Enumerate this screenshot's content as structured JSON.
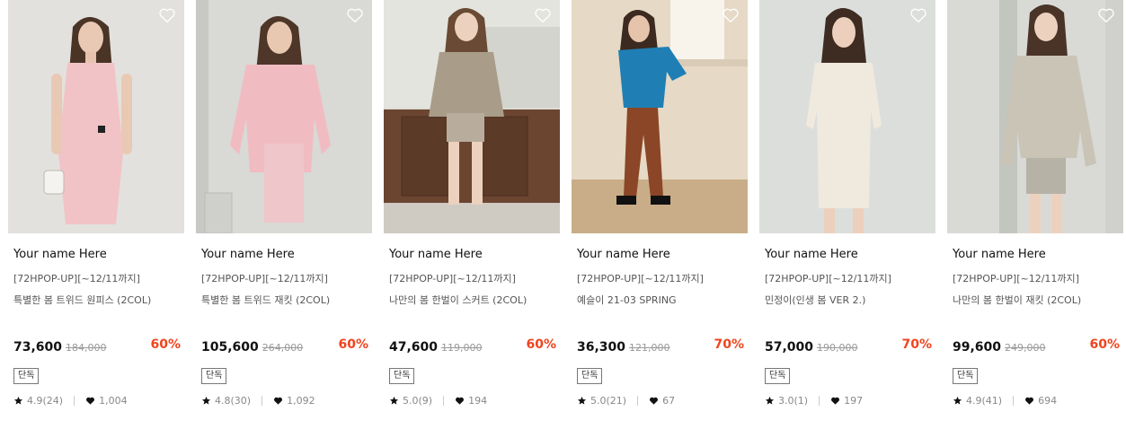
{
  "products": [
    {
      "brand": "Your name Here",
      "promo": "[72HPOP-UP][~12/11까지]",
      "name": "특별한 봄 트위드 원피스 (2COL)",
      "price": "73,600",
      "original_price": "184,000",
      "discount": "60%",
      "badge": "단독",
      "rating": "4.9(24)",
      "likes": "1,004"
    },
    {
      "brand": "Your name Here",
      "promo": "[72HPOP-UP][~12/11까지]",
      "name": "특별한 봄 트위드 재킷 (2COL)",
      "price": "105,600",
      "original_price": "264,000",
      "discount": "60%",
      "badge": "단독",
      "rating": "4.8(30)",
      "likes": "1,092"
    },
    {
      "brand": "Your name Here",
      "promo": "[72HPOP-UP][~12/11까지]",
      "name": "나만의 봄 한벌이 스커트 (2COL)",
      "price": "47,600",
      "original_price": "119,000",
      "discount": "60%",
      "badge": "단독",
      "rating": "5.0(9)",
      "likes": "194"
    },
    {
      "brand": "Your name Here",
      "promo": "[72HPOP-UP][~12/11까지]",
      "name": "예슬이 21-03 SPRING",
      "price": "36,300",
      "original_price": "121,000",
      "discount": "70%",
      "badge": "단독",
      "rating": "5.0(21)",
      "likes": "67"
    },
    {
      "brand": "Your name Here",
      "promo": "[72HPOP-UP][~12/11까지]",
      "name": "민정이(인생 봄 VER 2.)",
      "price": "57,000",
      "original_price": "190,000",
      "discount": "70%",
      "badge": "단독",
      "rating": "3.0(1)",
      "likes": "197"
    },
    {
      "brand": "Your name Here",
      "promo": "[72HPOP-UP][~12/11까지]",
      "name": "나만의 봄 한벌이 재킷 (2COL)",
      "price": "99,600",
      "original_price": "249,000",
      "discount": "60%",
      "badge": "단독",
      "rating": "4.9(41)",
      "likes": "694"
    }
  ],
  "icons": {
    "wishlist": "heart-outline-icon",
    "rating": "star-icon",
    "likes": "heart-filled-icon"
  },
  "colors": {
    "discount": "#f0441e",
    "text": "#111111",
    "muted": "#888888"
  }
}
